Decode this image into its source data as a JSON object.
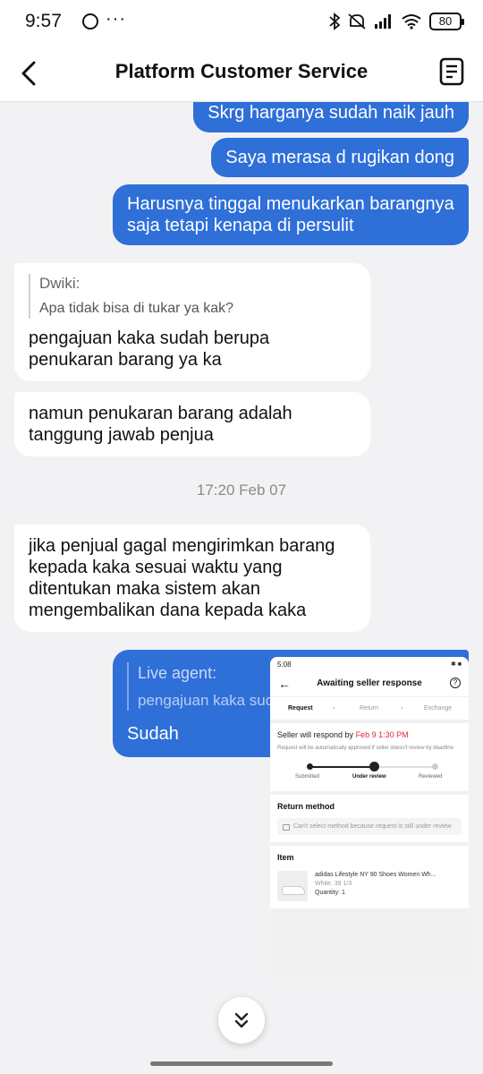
{
  "status_bar": {
    "time": "9:57",
    "overflow": "···",
    "battery": "80"
  },
  "header": {
    "title": "Platform Customer Service"
  },
  "messages": {
    "out1": "Skrg harganya sudah naik jauh",
    "out2": "Saya merasa d rugikan dong",
    "out3": "Harusnya tinggal menukarkan barangnya saja tetapi kenapa di persulit",
    "in1": {
      "quote_name": "Dwiki:",
      "quote_text": "Apa tidak bisa di tukar ya kak?",
      "text": "pengajuan kaka sudah berupa penukaran barang ya ka"
    },
    "in2": "namun penukaran barang adalah tanggung jawab penjua",
    "timestamp": "17:20 Feb 07",
    "in3": "jika penjual gagal mengirimkan barang kepada kaka sesuai waktu yang ditentukan maka sistem akan mengembalikan dana kepada kaka",
    "out4": {
      "quote_name": "Live agent:",
      "quote_text": "pengajuan kaka sudah berupa penukaran bara...",
      "text": "Sudah"
    }
  },
  "screenshot": {
    "time": "5:08",
    "title": "Awaiting seller response",
    "steps": [
      "Request",
      "Return",
      "Exchange"
    ],
    "respond_label": "Seller will respond by",
    "respond_date": "Feb 9 1:30 PM",
    "note": "Request will be automatically approved if seller doesn't review by deadline",
    "track": [
      "Submitted",
      "Under review",
      "Reviewed"
    ],
    "return_method_title": "Return method",
    "return_method_note": "Can't select method because request is still under review",
    "item_title": "Item",
    "product_name": "adidas Lifestyle NY 90 Shoes Women Wh...",
    "product_variant": "White, 39 1/3",
    "product_qty": "Quantity: 1"
  }
}
